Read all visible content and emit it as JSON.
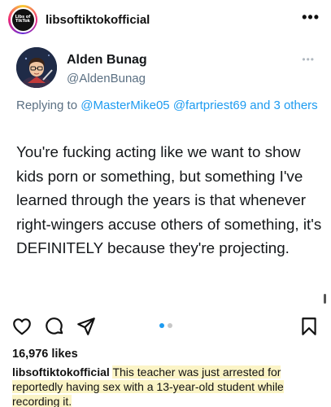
{
  "header": {
    "username": "libsoftiktokofficial",
    "avatar_text": "Libs of TikTok",
    "more_label": "•••"
  },
  "tweet": {
    "display_name": "Alden Bunag",
    "handle": "@AldenBunag",
    "more_label": "•••",
    "replying_prefix": "Replying to",
    "mentions": [
      "@MasterMike05",
      "@fartpriest69"
    ],
    "replying_and": "and 3 others",
    "text": "You're fucking acting like we want to show kids porn or something, but something I've learned through the years is that whenever right-wingers accuse others of something, it's DEFINITELY because they're projecting."
  },
  "actions": {
    "icons": [
      "heart-icon",
      "comment-icon",
      "share-icon",
      "bookmark-icon"
    ],
    "carousel_dots": 2,
    "carousel_active": 1
  },
  "post": {
    "likes": "16,976 likes",
    "caption_user": "libsoftiktokofficial",
    "caption_text": "This teacher was just arrested for reportedly having sex with a 13-year-old student while recording it."
  },
  "colors": {
    "mention": "#1d9bf0",
    "muted": "#5b7083",
    "dot_active": "#1d9bf0",
    "dot_inactive": "#c7c7c7",
    "highlight": "#fbf4c6"
  }
}
